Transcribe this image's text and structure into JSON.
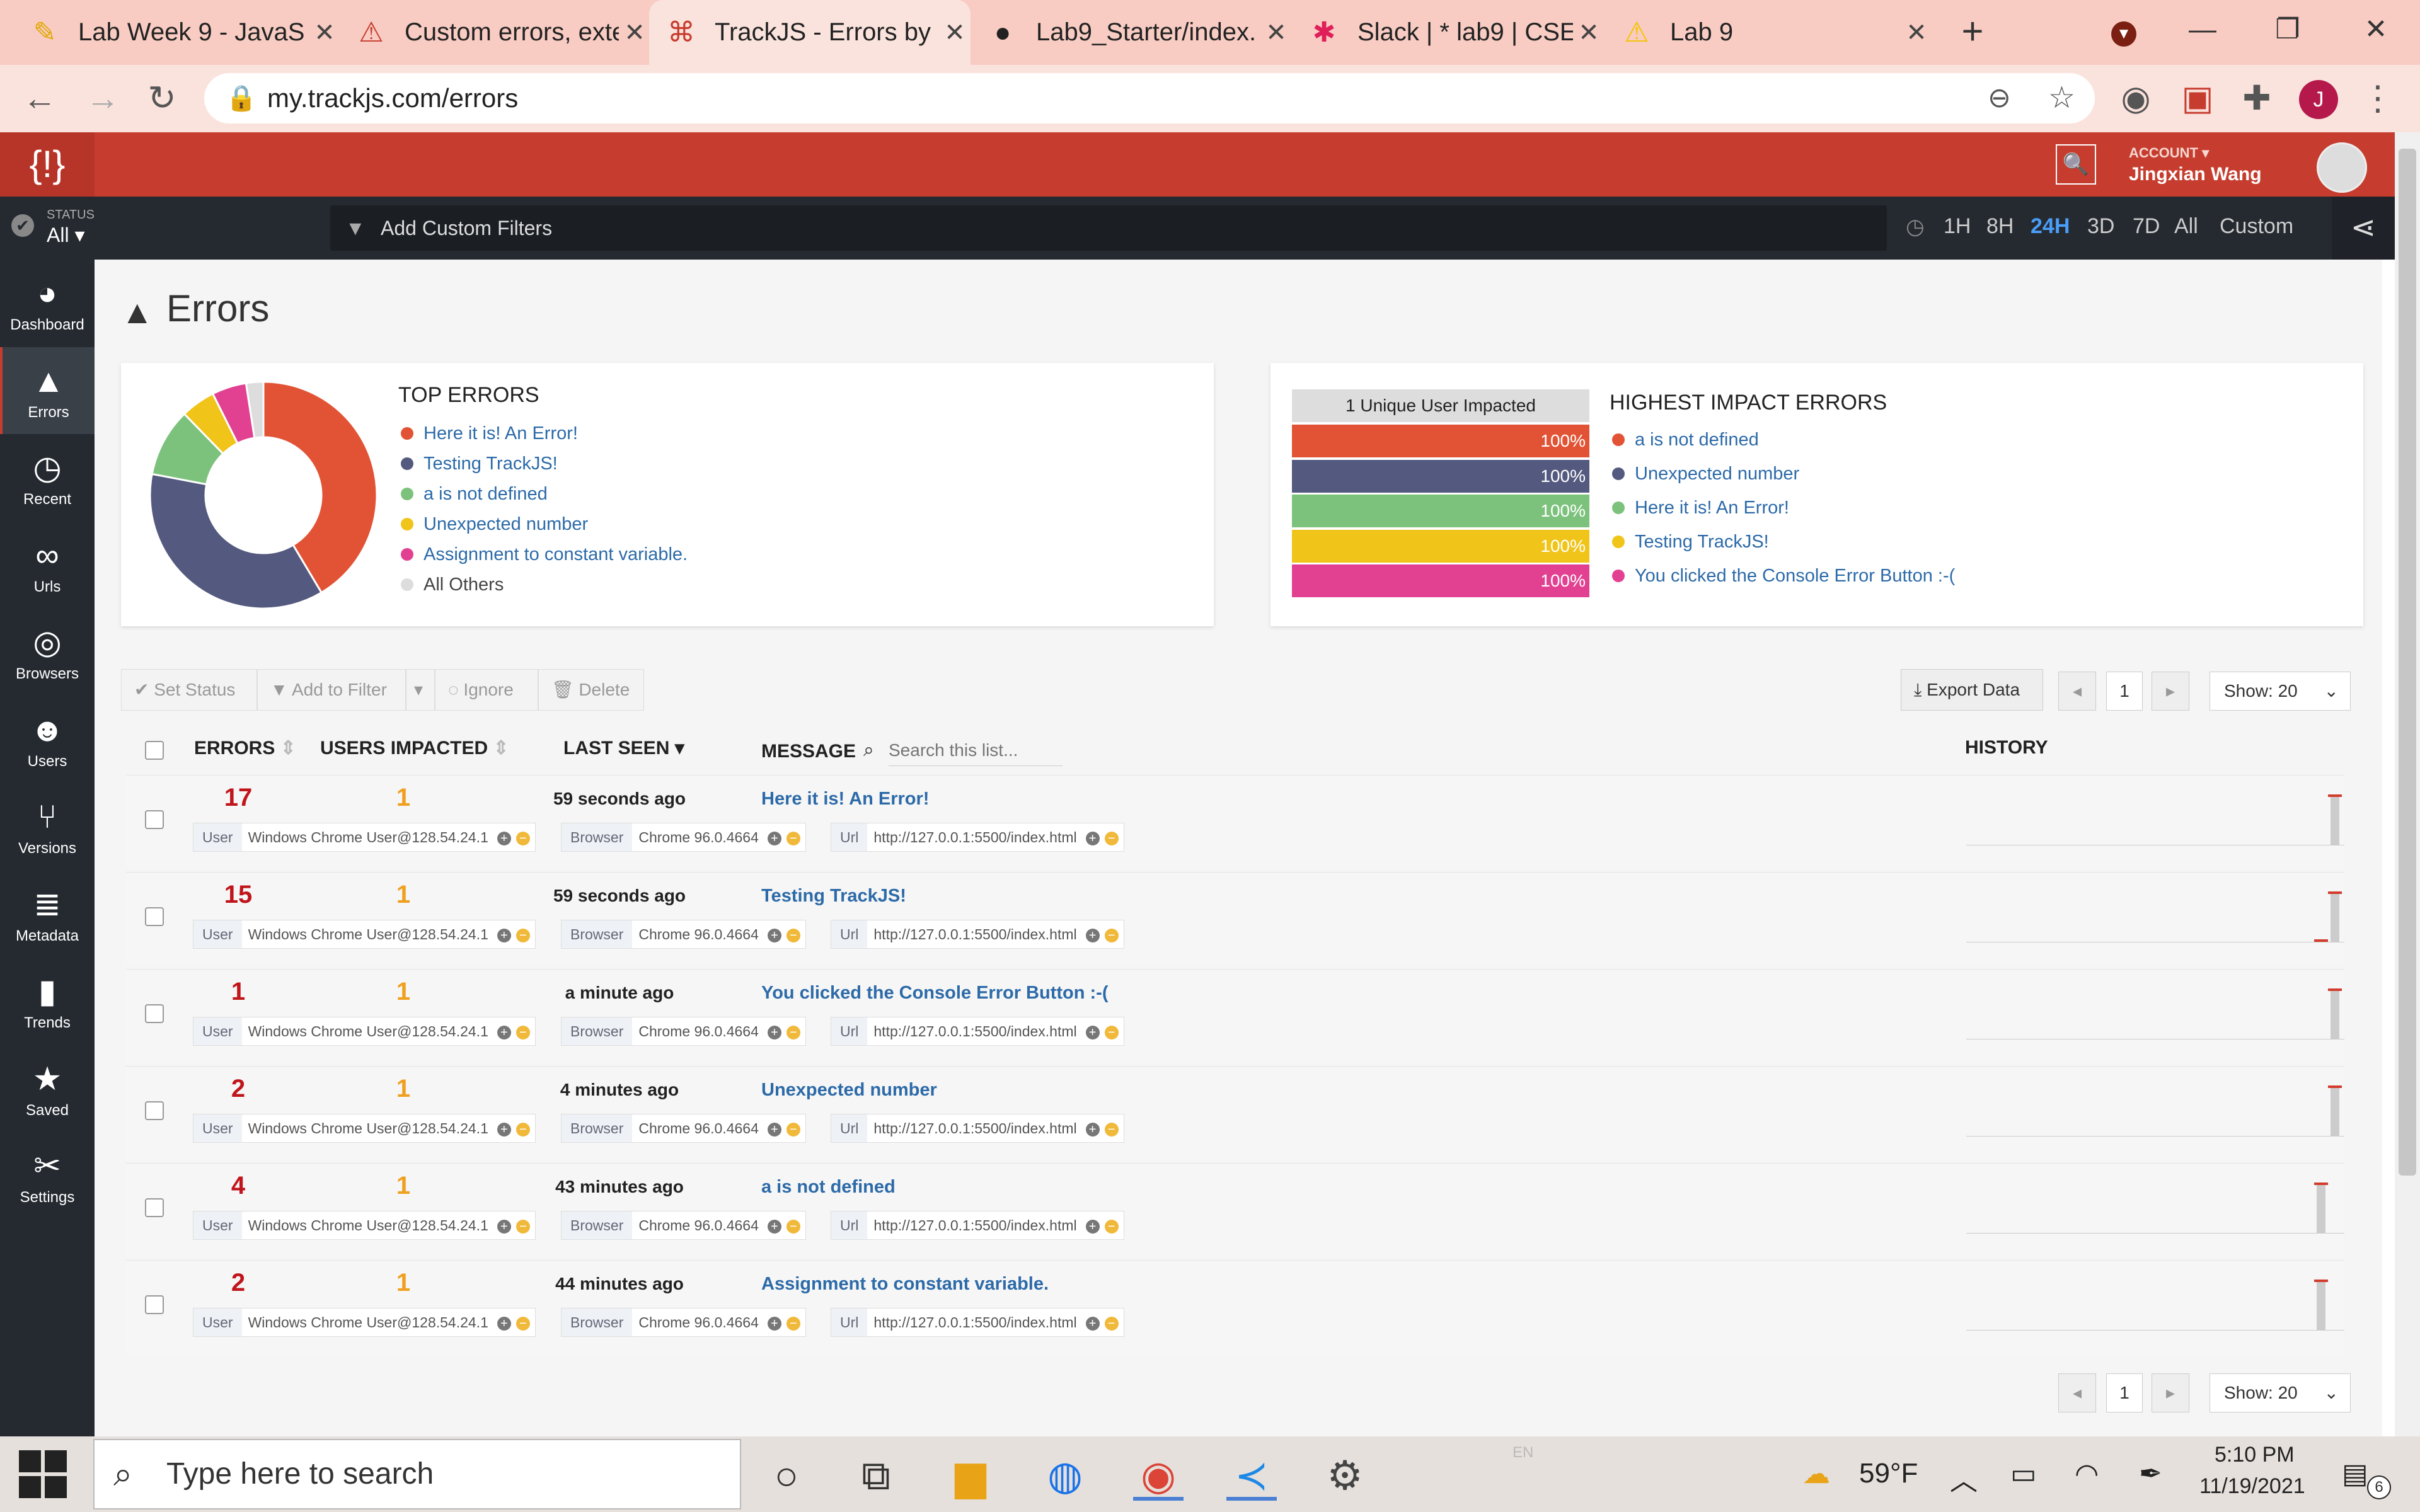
{
  "browser": {
    "tabs": [
      {
        "title": "Lab Week 9 - JavaS",
        "icon": "✎",
        "color": "#e0a800"
      },
      {
        "title": "Custom errors, exte",
        "icon": "⚠",
        "color": "#c63d2f"
      },
      {
        "title": "TrackJS - Errors by N",
        "icon": "⌘",
        "color": "#c63d2f"
      },
      {
        "title": "Lab9_Starter/index.",
        "icon": "●",
        "color": "#222"
      },
      {
        "title": "Slack | * lab9 | CSE",
        "icon": "✱",
        "color": "#e01e5a"
      },
      {
        "title": "Lab 9",
        "icon": "⚠",
        "color": "#f5c400"
      }
    ],
    "close_glyph": "✕",
    "new_tab": "+",
    "url": "my.trackjs.com/errors",
    "profile_initial": "J"
  },
  "header": {
    "account_label": "ACCOUNT",
    "account_name": "Jingxian Wang"
  },
  "filterbar": {
    "status_label": "STATUS",
    "status_value": "All",
    "custom_filters": "Add Custom Filters",
    "time_ranges": [
      "1H",
      "8H",
      "24H",
      "3D",
      "7D",
      "All",
      "Custom"
    ],
    "active_range": "24H"
  },
  "sidebar": {
    "items": [
      {
        "label": "Dashboard",
        "icon": "dashboard-icon"
      },
      {
        "label": "Errors",
        "icon": "warning-icon"
      },
      {
        "label": "Recent",
        "icon": "clock-icon"
      },
      {
        "label": "Urls",
        "icon": "link-icon"
      },
      {
        "label": "Browsers",
        "icon": "globe-icon"
      },
      {
        "label": "Users",
        "icon": "users-icon"
      },
      {
        "label": "Versions",
        "icon": "branch-icon"
      },
      {
        "label": "Metadata",
        "icon": "database-icon"
      },
      {
        "label": "Trends",
        "icon": "bar-chart-icon"
      },
      {
        "label": "Saved",
        "icon": "star-icon"
      },
      {
        "label": "Settings",
        "icon": "tools-icon"
      }
    ]
  },
  "page": {
    "title": "Errors"
  },
  "top_errors": {
    "heading": "TOP ERRORS",
    "items": [
      {
        "label": "Here it is! An Error!",
        "color": "#e25335",
        "share": 40.5
      },
      {
        "label": "Testing TrackJS!",
        "color": "#545a7f",
        "share": 35.7
      },
      {
        "label": "a is not defined",
        "color": "#7cc27c",
        "share": 9.5
      },
      {
        "label": "Unexpected number",
        "color": "#f0c419",
        "share": 4.8
      },
      {
        "label": "Assignment to constant variable.",
        "color": "#e24191",
        "share": 4.8
      },
      {
        "label": "All Others",
        "color": "#dddddd",
        "share": 2.4
      }
    ]
  },
  "highest_impact": {
    "heading": "HIGHEST IMPACT ERRORS",
    "users_header": "1 Unique User Impacted",
    "items": [
      {
        "label": "a is not defined",
        "percent": "100%",
        "color": "#e25335"
      },
      {
        "label": "Unexpected number",
        "percent": "100%",
        "color": "#545a7f"
      },
      {
        "label": "Here it is! An Error!",
        "percent": "100%",
        "color": "#7cc27c"
      },
      {
        "label": "Testing TrackJS!",
        "percent": "100%",
        "color": "#f0c419"
      },
      {
        "label": "You clicked the Console Error Button :-(",
        "percent": "100%",
        "color": "#e24191"
      }
    ]
  },
  "actions": {
    "set_status": "Set Status",
    "add_to_filter": "Add to Filter",
    "ignore": "Ignore",
    "delete": "Delete",
    "export": "Export Data",
    "page": "1",
    "show": "Show: 20"
  },
  "table": {
    "columns": {
      "errors": "ERRORS",
      "users": "USERS IMPACTED",
      "last_seen": "LAST SEEN",
      "message": "MESSAGE",
      "search_placeholder": "Search this list...",
      "history": "HISTORY"
    },
    "tag_keys": {
      "user": "User",
      "browser": "Browser",
      "url": "Url"
    },
    "rows": [
      {
        "errors": "17",
        "users": "1",
        "last_seen": "59 seconds ago",
        "message": "Here it is! An Error!",
        "user": "Windows Chrome User@128.54.24.1",
        "browser": "Chrome 96.0.4664",
        "url": "http://127.0.0.1:5500/index.html",
        "history": [
          0.0,
          0.95
        ]
      },
      {
        "errors": "15",
        "users": "1",
        "last_seen": "59 seconds ago",
        "message": "Testing TrackJS!",
        "user": "Windows Chrome User@128.54.24.1",
        "browser": "Chrome 96.0.4664",
        "url": "http://127.0.0.1:5500/index.html",
        "history": [
          0.05,
          0.95
        ]
      },
      {
        "errors": "1",
        "users": "1",
        "last_seen": "a minute ago",
        "message": "You clicked the Console Error Button :-(",
        "user": "Windows Chrome User@128.54.24.1",
        "browser": "Chrome 96.0.4664",
        "url": "http://127.0.0.1:5500/index.html",
        "history": [
          0.0,
          0.95
        ]
      },
      {
        "errors": "2",
        "users": "1",
        "last_seen": "4 minutes ago",
        "message": "Unexpected number",
        "user": "Windows Chrome User@128.54.24.1",
        "browser": "Chrome 96.0.4664",
        "url": "http://127.0.0.1:5500/index.html",
        "history": [
          0.0,
          0.95
        ]
      },
      {
        "errors": "4",
        "users": "1",
        "last_seen": "43 minutes ago",
        "message": "a is not defined",
        "user": "Windows Chrome User@128.54.24.1",
        "browser": "Chrome 96.0.4664",
        "url": "http://127.0.0.1:5500/index.html",
        "history": [
          0.95,
          0.0
        ]
      },
      {
        "errors": "2",
        "users": "1",
        "last_seen": "44 minutes ago",
        "message": "Assignment to constant variable.",
        "user": "Windows Chrome User@128.54.24.1",
        "browser": "Chrome 96.0.4664",
        "url": "http://127.0.0.1:5500/index.html",
        "history": [
          0.95,
          0.0
        ]
      }
    ]
  },
  "taskbar": {
    "search_placeholder": "Type here to search",
    "weather": "59°F",
    "time": "5:10 PM",
    "date": "11/19/2021",
    "lang": "EN",
    "notifications": "6"
  }
}
